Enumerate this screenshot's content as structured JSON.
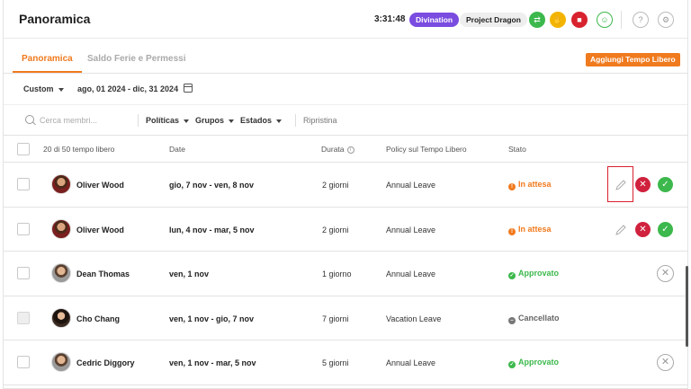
{
  "header": {
    "title": "Panoramica",
    "clock": "3:31:48",
    "workspace_pill": "Divination",
    "project_pill": "Project Dragon",
    "icons": [
      "transfer-icon",
      "hand-icon",
      "stop-icon",
      "user-icon",
      "help-icon",
      "settings-icon"
    ]
  },
  "tabs": [
    {
      "label": "Panoramica",
      "active": true
    },
    {
      "label": "Saldo Ferie e Permessi",
      "active": false
    }
  ],
  "add_button": "Aggiungi Tempo Libero",
  "range": {
    "preset": "Custom",
    "dates": "ago, 01 2024 - dic, 31 2024"
  },
  "filters": {
    "search_placeholder": "Cerca membri...",
    "policies": "Políticas",
    "groups": "Grupos",
    "states": "Estados",
    "reset": "Ripristina"
  },
  "table": {
    "headers": {
      "count": "20 di 50 tempo libero",
      "date": "Date",
      "duration": "Durata",
      "policy": "Policy sul Tempo Libero",
      "status": "Stato"
    },
    "rows": [
      {
        "name": "Oliver Wood",
        "date": "gio, 7 nov - ven, 8 nov",
        "duration": "2 giorni",
        "policy": "Annual Leave",
        "status": "In attesa"
      },
      {
        "name": "Oliver Wood",
        "date": "lun, 4 nov - mar, 5 nov",
        "duration": "2 giorni",
        "policy": "Annual Leave",
        "status": "In attesa"
      },
      {
        "name": "Dean Thomas",
        "date": "ven, 1 nov",
        "duration": "1 giorno",
        "policy": "Annual Leave",
        "status": "Approvato"
      },
      {
        "name": "Cho Chang",
        "date": "ven, 1 nov - gio, 7 nov",
        "duration": "7 giorni",
        "policy": "Vacation Leave",
        "status": "Cancellato"
      },
      {
        "name": "Cedric Diggory",
        "date": "ven, 1 nov - mar, 5 nov",
        "duration": "5 giorni",
        "policy": "Annual Leave",
        "status": "Approvato"
      }
    ]
  },
  "colors": {
    "accent": "#f07a1e",
    "approve": "#3cb84c",
    "reject": "#d0213d",
    "workspace": "#7a4ce0"
  }
}
